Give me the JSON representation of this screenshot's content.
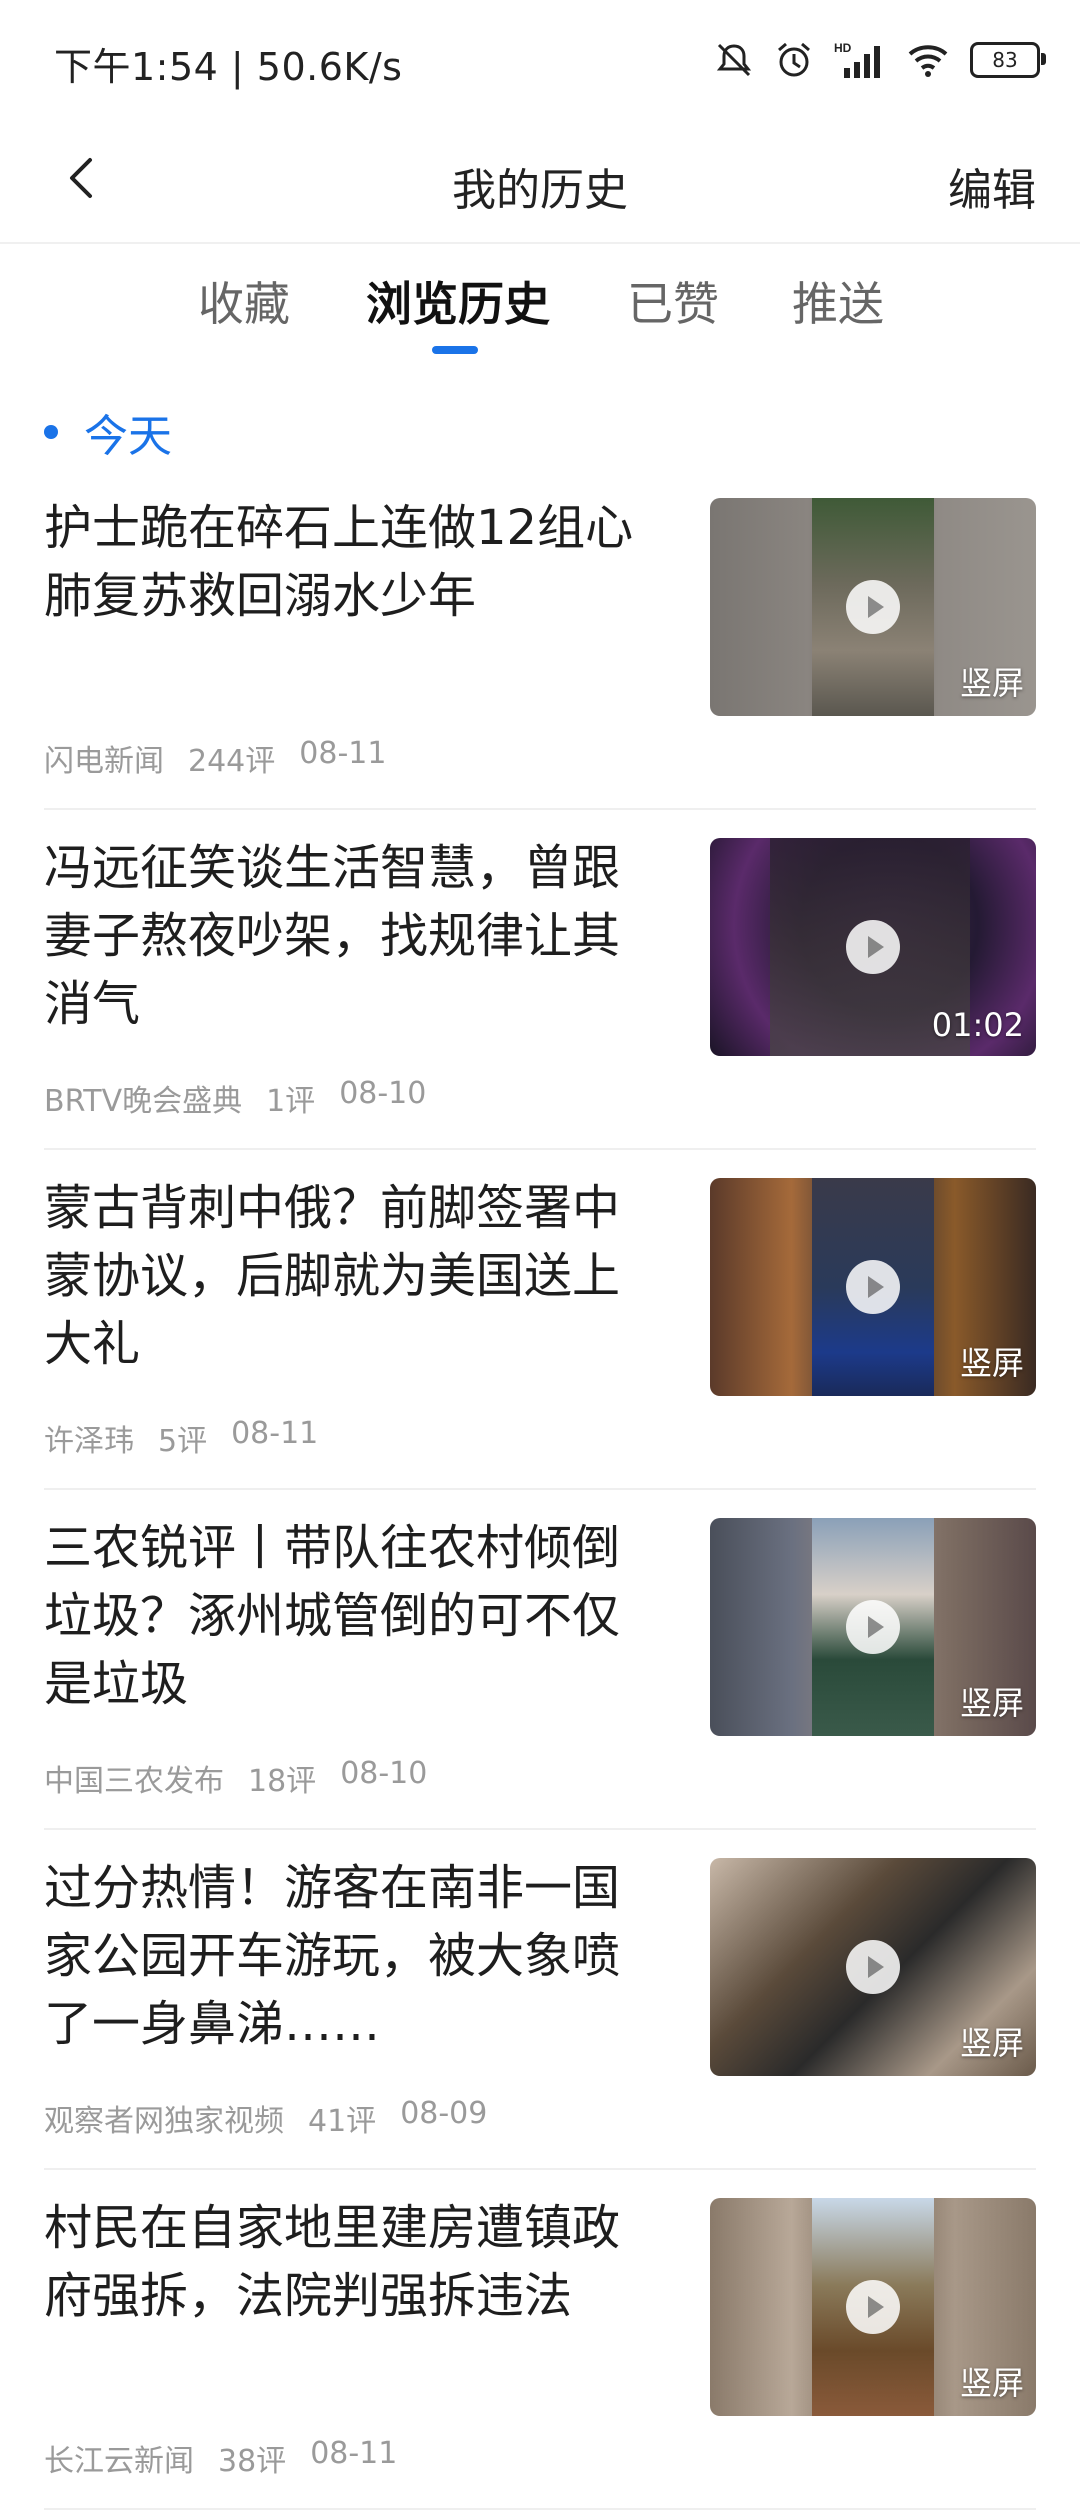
{
  "status_bar": {
    "time": "下午1:54 | 50.6K/s",
    "battery": "83",
    "icons": [
      "mute-bell-icon",
      "alarm-icon",
      "hd-signal-icon",
      "wifi-icon",
      "battery-icon"
    ]
  },
  "header": {
    "title": "我的历史",
    "edit_label": "编辑",
    "back_icon": "chevron-left-icon"
  },
  "tabs": [
    {
      "label": "收藏",
      "active": false
    },
    {
      "label": "浏览历史",
      "active": true
    },
    {
      "label": "已赞",
      "active": false
    },
    {
      "label": "推送",
      "active": false
    }
  ],
  "section": {
    "label": "今天"
  },
  "items": [
    {
      "title": "护士跪在碎石上连做12组心肺复苏救回溺水少年",
      "source": "闪电新闻",
      "comments": "244评",
      "date": "08-11",
      "badge": "竖屏"
    },
    {
      "title": "冯远征笑谈生活智慧，曾跟妻子熬夜吵架，找规律让其消气",
      "source": "BRTV晚会盛典",
      "comments": "1评",
      "date": "08-10",
      "badge": "01:02"
    },
    {
      "title": "蒙古背刺中俄？前脚签署中蒙协议，后脚就为美国送上大礼",
      "source": "许泽玮",
      "comments": "5评",
      "date": "08-11",
      "badge": "竖屏"
    },
    {
      "title": "三农锐评丨带队往农村倾倒垃圾？涿州城管倒的可不仅是垃圾",
      "source": "中国三农发布",
      "comments": "18评",
      "date": "08-10",
      "badge": "竖屏"
    },
    {
      "title": "过分热情！游客在南非一国家公园开车游玩，被大象喷了一身鼻涕……",
      "source": "观察者网独家视频",
      "comments": "41评",
      "date": "08-09",
      "badge": "竖屏"
    },
    {
      "title": "村民在自家地里建房遭镇政府强拆，法院判强拆违法",
      "source": "长江云新闻",
      "comments": "38评",
      "date": "08-11",
      "badge": "竖屏"
    }
  ],
  "colors": {
    "accent": "#1a73e8",
    "meta": "#9a9a9a",
    "title": "#1e1e1e"
  }
}
